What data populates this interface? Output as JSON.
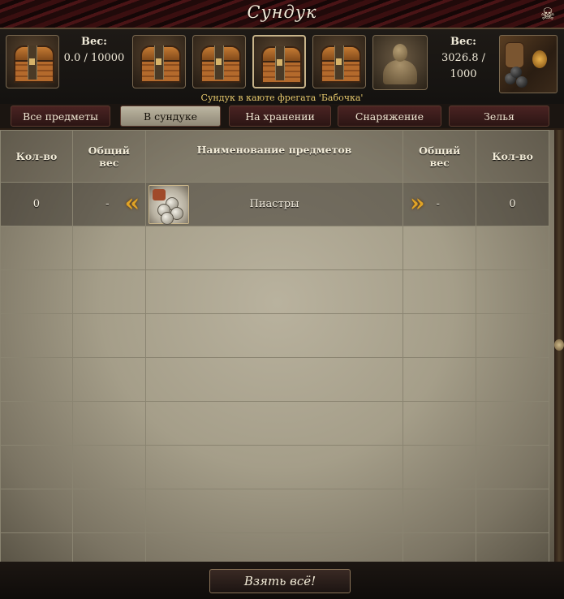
{
  "window": {
    "title": "Сундук",
    "close_icon": "skull-crossbones-icon"
  },
  "left_weight": {
    "label": "Вес:",
    "value": "0.0 / 10000"
  },
  "right_weight": {
    "label": "Вес:",
    "value_line1": "3026.8 /",
    "value_line2": "1000"
  },
  "chest_subtitle": "Сундук в каюте фрегата 'Бабочка'",
  "tabs": [
    {
      "label": "Все предметы",
      "active": false
    },
    {
      "label": "В сундуке",
      "active": true
    },
    {
      "label": "На хранении",
      "active": false
    },
    {
      "label": "Снаряжение",
      "active": false
    },
    {
      "label": "Зелья",
      "active": false
    }
  ],
  "table": {
    "headers": {
      "qty_left": "Кол-во",
      "weight_left_line1": "Общий",
      "weight_left_line2": "вес",
      "name": "Наименование предметов",
      "weight_right_line1": "Общий",
      "weight_right_line2": "вес",
      "qty_right": "Кол-во"
    },
    "rows": [
      {
        "qty_left": "0",
        "weight_left": "-",
        "name": "Пиастры",
        "weight_right": "-",
        "qty_right": "0",
        "icon": "coins-pouch-icon"
      }
    ]
  },
  "footer": {
    "take_all": "Взять всё!"
  }
}
